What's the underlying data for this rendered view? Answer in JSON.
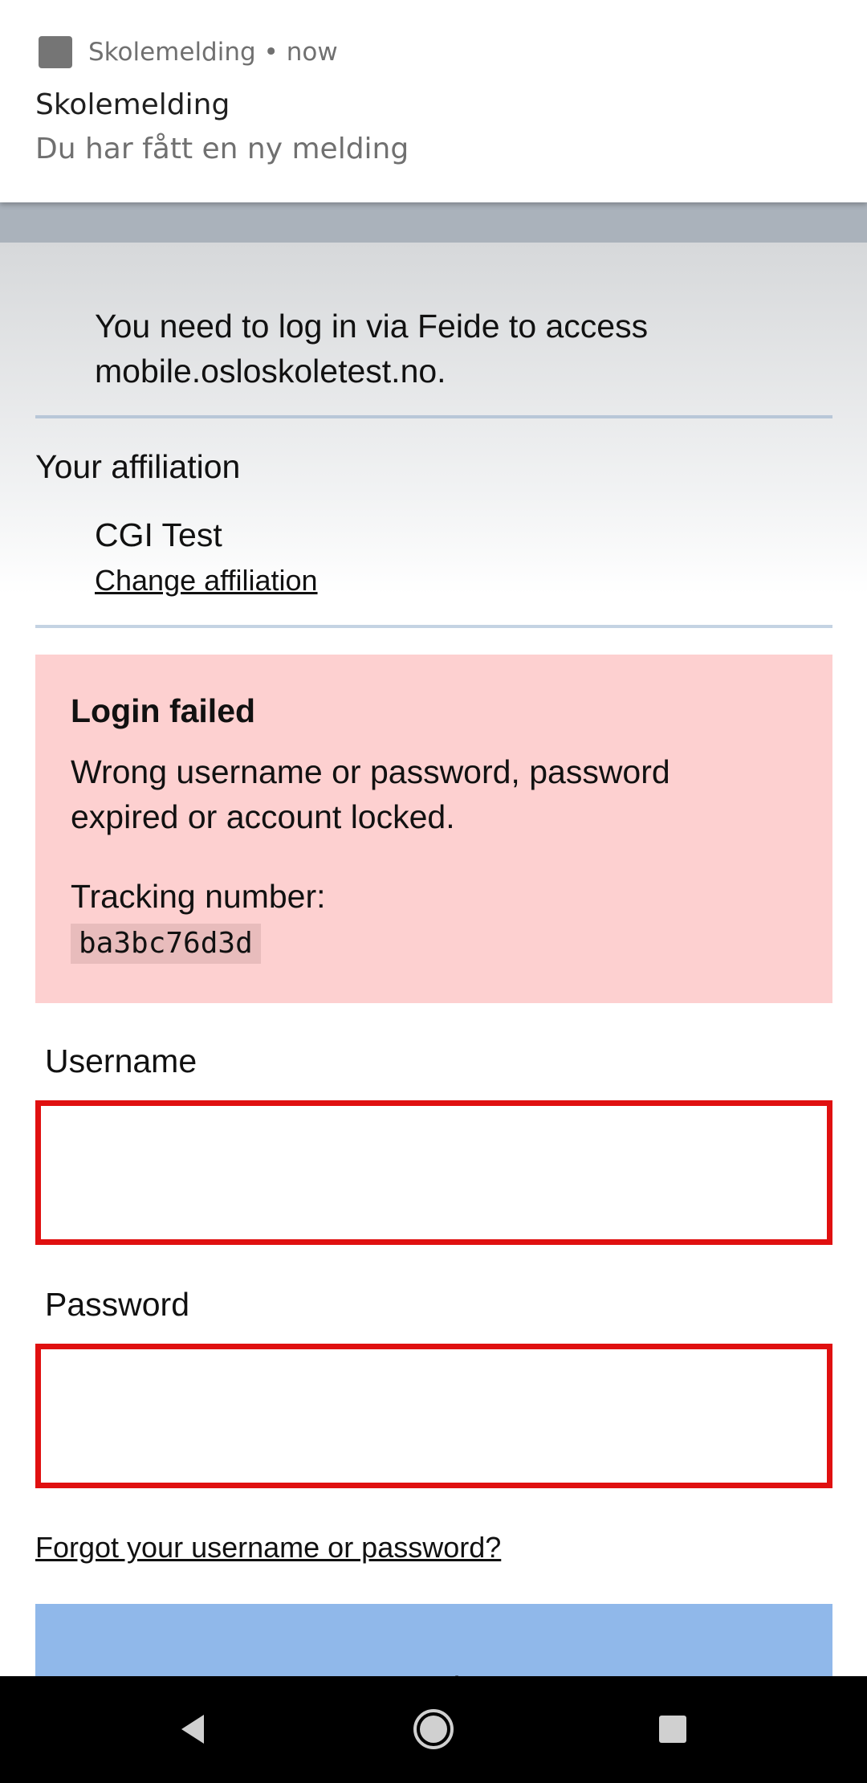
{
  "notification": {
    "app_name": "Skolemelding",
    "separator": "•",
    "time": "now",
    "title": "Skolemelding",
    "body": "Du har fått en ny melding",
    "icon": "app-icon"
  },
  "login": {
    "intro_line1": "You need to log in via Feide to access",
    "intro_line2": "mobile.osloskoletest.no.",
    "affiliation_label": "Your affiliation",
    "affiliation_name": "CGI Test",
    "change_affiliation": "Change affiliation",
    "error": {
      "title": "Login failed",
      "message_line1": "Wrong username or password, password",
      "message_line2": "expired or account locked.",
      "tracking_label": "Tracking number:",
      "tracking_code": "ba3bc76d3d"
    },
    "username_label": "Username",
    "username_value": "",
    "password_label": "Password",
    "password_value": "",
    "forgot_link": "Forgot your username or password?",
    "login_button": "Log in"
  },
  "colors": {
    "error_background": "#fdd0d0",
    "error_border": "#e01010",
    "login_button": "#90b8ea",
    "topbar": "#aab2bb"
  },
  "navbar": {
    "back_icon": "back-triangle-icon",
    "home_icon": "home-circle-icon",
    "recents_icon": "recents-square-icon"
  }
}
